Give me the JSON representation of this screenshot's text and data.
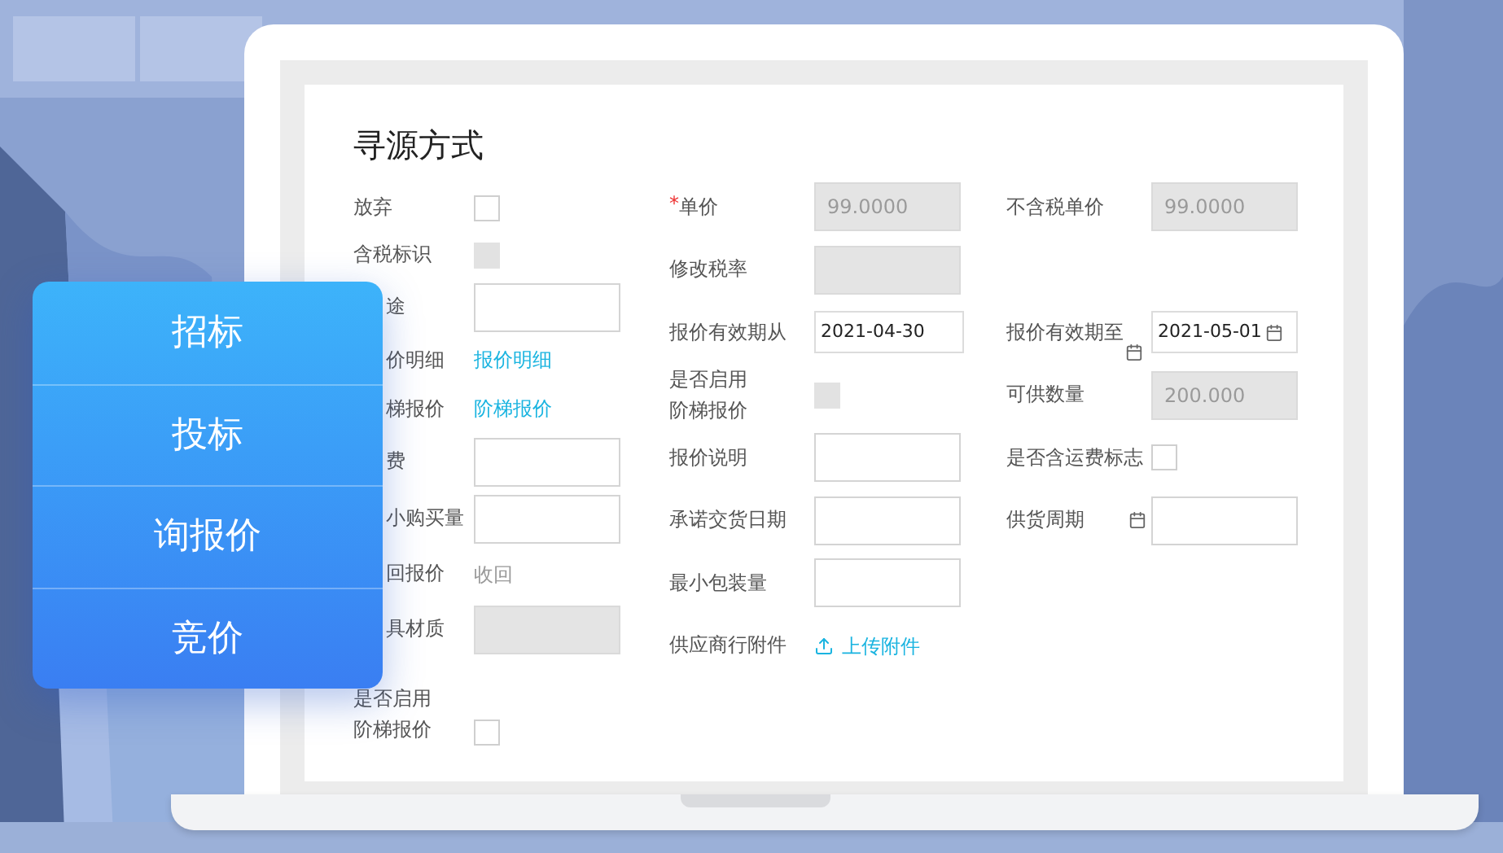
{
  "menu": {
    "items": [
      {
        "label": "招标"
      },
      {
        "label": "投标"
      },
      {
        "label": "询报价"
      },
      {
        "label": "竞价"
      }
    ]
  },
  "form": {
    "title": "寻源方式",
    "left_fields": [
      {
        "kind": "checkbox",
        "label": "放弃",
        "disabled": false
      },
      {
        "kind": "checkbox",
        "label": "含税标识",
        "disabled": true
      },
      {
        "kind": "input",
        "label": "途",
        "covered": true,
        "disabled": false
      },
      {
        "kind": "link",
        "label": "价明细",
        "covered": true,
        "value": "报价明细"
      },
      {
        "kind": "link",
        "label": "梯报价",
        "covered": true,
        "value": "阶梯报价"
      },
      {
        "kind": "input",
        "label": "费",
        "covered": true,
        "disabled": false
      },
      {
        "kind": "input",
        "label": "小购买量",
        "covered": true,
        "disabled": false
      },
      {
        "kind": "text",
        "label": "回报价",
        "covered": true,
        "value": "收回"
      },
      {
        "kind": "input",
        "label": "具材质",
        "covered": true,
        "disabled": true
      },
      {
        "kind": "checkbox",
        "label_lines": [
          "是否启用",
          "阶梯报价"
        ],
        "disabled": false
      }
    ],
    "rows": [
      {
        "fields": [
          {
            "kind": "input",
            "required_mark": "*",
            "label": "单价",
            "disabled": true,
            "value": "99.0000"
          },
          {
            "kind": "input",
            "label": "不含税单价",
            "disabled": true,
            "value": "99.0000"
          }
        ]
      },
      {
        "fields": [
          {
            "kind": "input",
            "label": "修改税率",
            "disabled": true
          }
        ]
      },
      {
        "fields": [
          {
            "kind": "date",
            "label": "报价有效期从",
            "value": "2021-04-30"
          },
          {
            "kind": "date",
            "label": "报价有效期至",
            "label_icon": true,
            "value": "2021-05-01"
          }
        ]
      },
      {
        "fields": [
          {
            "kind": "checkbox",
            "label_lines": [
              "是否启用",
              "阶梯报价"
            ],
            "disabled": true
          },
          {
            "kind": "input",
            "label": "可供数量",
            "disabled": true,
            "value": "200.000"
          }
        ]
      },
      {
        "fields": [
          {
            "kind": "input",
            "label": "报价说明",
            "disabled": false
          },
          {
            "kind": "checkbox",
            "label": "是否含运费标志",
            "disabled": false
          }
        ]
      },
      {
        "fields": [
          {
            "kind": "input",
            "label": "承诺交货日期",
            "disabled": false
          },
          {
            "kind": "input",
            "label": "供货周期",
            "label_icon": true,
            "disabled": false
          }
        ]
      },
      {
        "fields": [
          {
            "kind": "input",
            "label": "最小包装量",
            "disabled": false
          }
        ]
      },
      {
        "fields": [
          {
            "kind": "upload",
            "label": "供应商行附件",
            "value": "上传附件"
          }
        ]
      }
    ]
  }
}
